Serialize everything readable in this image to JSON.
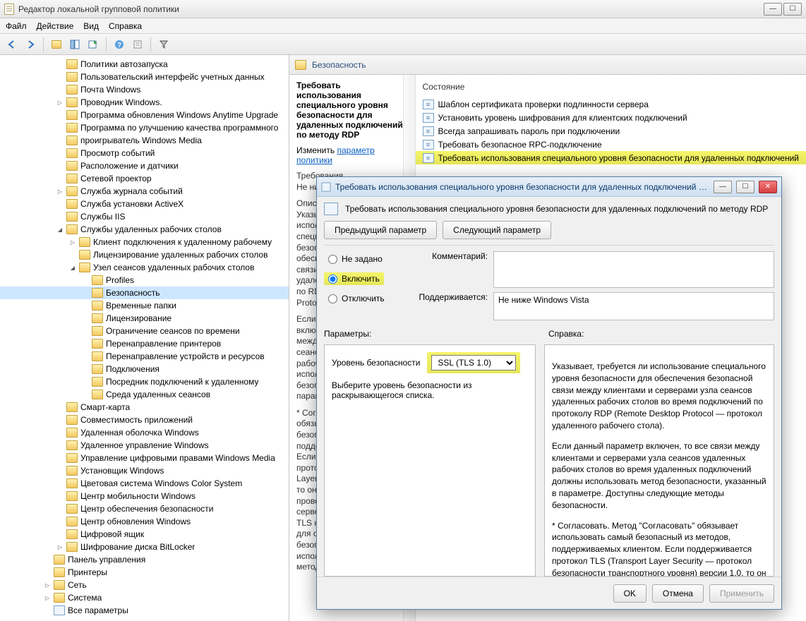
{
  "window": {
    "title": "Редактор локальной групповой политики"
  },
  "menu": {
    "file": "Файл",
    "action": "Действие",
    "view": "Вид",
    "help": "Справка"
  },
  "tree": [
    {
      "indent": 4,
      "arrow": "",
      "label": "Политики автозапуска"
    },
    {
      "indent": 4,
      "arrow": "",
      "label": "Пользовательский интерфейс учетных данных"
    },
    {
      "indent": 4,
      "arrow": "",
      "label": "Почта Windows"
    },
    {
      "indent": 4,
      "arrow": "▷",
      "label": "Проводник Windows."
    },
    {
      "indent": 4,
      "arrow": "",
      "label": "Программа обновления Windows Anytime Upgrade"
    },
    {
      "indent": 4,
      "arrow": "",
      "label": "Программа по улучшению качества программного"
    },
    {
      "indent": 4,
      "arrow": "",
      "label": "проигрыватель Windows Media"
    },
    {
      "indent": 4,
      "arrow": "",
      "label": "Просмотр событий"
    },
    {
      "indent": 4,
      "arrow": "",
      "label": "Расположение и датчики"
    },
    {
      "indent": 4,
      "arrow": "",
      "label": "Сетевой проектор"
    },
    {
      "indent": 4,
      "arrow": "▷",
      "label": "Служба журнала событий"
    },
    {
      "indent": 4,
      "arrow": "",
      "label": "Служба установки ActiveX"
    },
    {
      "indent": 4,
      "arrow": "",
      "label": "Службы IIS"
    },
    {
      "indent": 4,
      "arrow": "◢",
      "label": "Службы удаленных рабочих столов"
    },
    {
      "indent": 5,
      "arrow": "▷",
      "label": "Клиент подключения к удаленному рабочему"
    },
    {
      "indent": 5,
      "arrow": "",
      "label": "Лицензирование удаленных рабочих столов"
    },
    {
      "indent": 5,
      "arrow": "◢",
      "label": "Узел сеансов удаленных рабочих столов"
    },
    {
      "indent": 6,
      "arrow": "",
      "label": "Profiles"
    },
    {
      "indent": 6,
      "arrow": "",
      "label": "Безопасность",
      "selected": true
    },
    {
      "indent": 6,
      "arrow": "",
      "label": "Временные папки"
    },
    {
      "indent": 6,
      "arrow": "",
      "label": "Лицензирование"
    },
    {
      "indent": 6,
      "arrow": "",
      "label": "Ограничение сеансов по времени"
    },
    {
      "indent": 6,
      "arrow": "",
      "label": "Перенаправление принтеров"
    },
    {
      "indent": 6,
      "arrow": "",
      "label": "Перенаправление устройств и ресурсов"
    },
    {
      "indent": 6,
      "arrow": "",
      "label": "Подключения"
    },
    {
      "indent": 6,
      "arrow": "",
      "label": "Посредник подключений к удаленному"
    },
    {
      "indent": 6,
      "arrow": "",
      "label": "Среда удаленных сеансов"
    },
    {
      "indent": 4,
      "arrow": "",
      "label": "Смарт-карта"
    },
    {
      "indent": 4,
      "arrow": "",
      "label": "Совместимость приложений"
    },
    {
      "indent": 4,
      "arrow": "",
      "label": "Удаленная оболочка Windows"
    },
    {
      "indent": 4,
      "arrow": "",
      "label": "Удаленное управление Windows"
    },
    {
      "indent": 4,
      "arrow": "",
      "label": "Управление цифровыми правами Windows Media"
    },
    {
      "indent": 4,
      "arrow": "",
      "label": "Установщик Windows"
    },
    {
      "indent": 4,
      "arrow": "",
      "label": "Цветовая система Windows Color System"
    },
    {
      "indent": 4,
      "arrow": "",
      "label": "Центр мобильности Windows"
    },
    {
      "indent": 4,
      "arrow": "",
      "label": "Центр обеспечения безопасности"
    },
    {
      "indent": 4,
      "arrow": "",
      "label": "Центр обновления Windows"
    },
    {
      "indent": 4,
      "arrow": "",
      "label": "Цифровой ящик"
    },
    {
      "indent": 4,
      "arrow": "▷",
      "label": "Шифрование диска BitLocker"
    },
    {
      "indent": 3,
      "arrow": "",
      "label": "Панель управления"
    },
    {
      "indent": 3,
      "arrow": "",
      "label": "Принтеры"
    },
    {
      "indent": 3,
      "arrow": "▷",
      "label": "Сеть"
    },
    {
      "indent": 3,
      "arrow": "▷",
      "label": "Система"
    },
    {
      "indent": 3,
      "arrow": "",
      "label": "Все параметры",
      "allparams": true
    }
  ],
  "section": {
    "title": "Безопасность",
    "policy_heading": "Требовать использования специального уровня безопасности для удаленных подключений по методу RDP",
    "edit_prefix": "Изменить",
    "edit_link": "параметр политики",
    "req_label": "Требования",
    "req_text": "Не ниже W",
    "desc_label": "Описание",
    "desc_text": "Указывает, требуется ли использование специального уровня безопасности для обеспечения безопасной связи между узлом сеансов удаленных рабочих столов по RDP (Remote Desktop Protocol).",
    "desc_extra_1": "Если данный параметр включен, то все связи между серверами узла сеансов удаленных рабочих столов будут использовать метод безопасности, указанный в параметре.",
    "desc_extra_2": "* Согласовать. Метод обязывает использовать безопасность, поддерживаемую клиентом. Если поддерживается протокол TLS (Transport Layer Security) версии 1.0, то он используется для проверки подлинности сервера. Если протокол TLS не поддерживается, то для обеспечения безопасной связи используется исходный метод шифрования RDP."
  },
  "settings": {
    "col_header": "Состояние",
    "items": [
      {
        "label": "Шаблон сертификата проверки подлинности сервера"
      },
      {
        "label": "Установить уровень шифрования для клиентских подключений"
      },
      {
        "label": "Всегда запрашивать пароль при подключении"
      },
      {
        "label": "Требовать безопасное RPC-подключение"
      },
      {
        "label": "Требовать использования специального уровня безопасности для удаленных подключений",
        "highlight": true
      }
    ]
  },
  "dialog": {
    "titlebar": "Требовать использования специального уровня безопасности для удаленных подключений по мет...",
    "heading": "Требовать использования специального уровня безопасности для удаленных подключений по методу RDP",
    "prev": "Предыдущий параметр",
    "next": "Следующий параметр",
    "radio_notset": "Не задано",
    "radio_enabled": "Включить",
    "radio_disabled": "Отключить",
    "comment_label": "Комментарий:",
    "supported_label": "Поддерживается:",
    "supported_value": "Не ниже Windows Vista",
    "params_label": "Параметры:",
    "help_label": "Справка:",
    "sec_level_label": "Уровень безопасности",
    "sec_level_value": "SSL (TLS 1.0)",
    "sec_level_hint": "Выберите уровень безопасности из раскрывающегося списка.",
    "help_p1": "Указывает, требуется ли использование специального уровня безопасности для обеспечения безопасной связи между клиентами и серверами узла сеансов удаленных рабочих столов во время подключений по протоколу RDP (Remote Desktop Protocol — протокол удаленного рабочего стола).",
    "help_p2": "Если данный параметр включен, то все связи между клиентами и серверами узла сеансов удаленных рабочих столов во время удаленных подключений должны использовать метод безопасности, указанный в параметре. Доступны следующие методы безопасности.",
    "help_p3": "* Согласовать. Метод \"Согласовать\" обязывает использовать самый безопасный из методов, поддерживаемых клиентом. Если поддерживается протокол TLS (Transport Layer Security — протокол безопасности транспортного уровня) версии 1.0, то он используется для проверки подлинности сервера узла сеансов удаленных рабочих столов. Если протокол TLS не поддерживается, то для обеспечения безопасной связи",
    "ok": "OK",
    "cancel": "Отмена",
    "apply": "Применить"
  }
}
